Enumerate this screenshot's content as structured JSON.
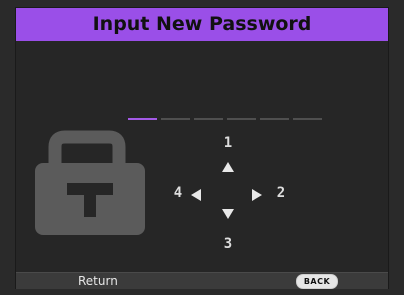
{
  "dialog": {
    "title": "Input New Password"
  },
  "password": {
    "slots_total": 6,
    "slots_filled": 1,
    "accent": "#9a4fe8"
  },
  "keypad": {
    "up_label": "1",
    "right_label": "2",
    "down_label": "3",
    "left_label": "4"
  },
  "icons": {
    "lock": "lock-icon",
    "up": "arrow-up-icon",
    "down": "arrow-down-icon",
    "left": "arrow-left-icon",
    "right": "arrow-right-icon"
  },
  "footer": {
    "return_label": "Return",
    "back_button": "BACK"
  }
}
